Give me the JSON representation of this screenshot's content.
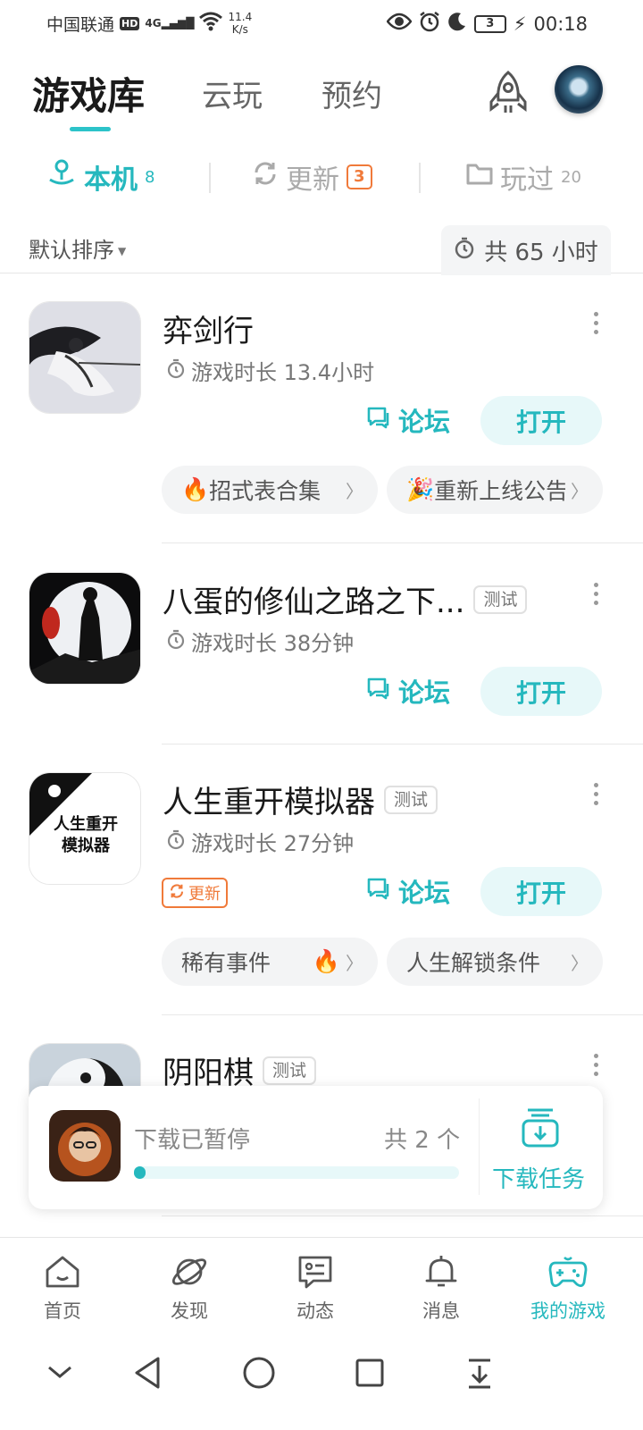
{
  "status": {
    "carrier": "中国联通",
    "hd": "HD",
    "network": "4G",
    "speed_value": "11.4",
    "speed_unit": "K/s",
    "battery": "3",
    "time": "00:18"
  },
  "tabs": [
    "游戏库",
    "云玩",
    "预约"
  ],
  "sub_tabs": {
    "local": {
      "label": "本机",
      "count": "8"
    },
    "update": {
      "label": "更新",
      "count": "3"
    },
    "played": {
      "label": "玩过",
      "count": "20"
    }
  },
  "sort": {
    "label": "默认排序",
    "total_time": "共 65 小时"
  },
  "forum_label": "论坛",
  "open_label": "打开",
  "test_tag": "测试",
  "update_tag": "更新",
  "games": [
    {
      "title": "弈剑行",
      "playtime": "游戏时长 13.4小时",
      "chips": [
        "招式表合集",
        "重新上线公告"
      ]
    },
    {
      "title": "八蛋的修仙之路之下...",
      "playtime": "游戏时长 38分钟"
    },
    {
      "title": "人生重开模拟器",
      "playtime": "游戏时长 27分钟",
      "icon_text_line1": "人生重开",
      "icon_text_line2": "模拟器",
      "chips": [
        "稀有事件",
        "人生解锁条件"
      ]
    },
    {
      "title": "阴阳棋"
    }
  ],
  "download": {
    "status": "下载已暂停",
    "count": "共 2 个",
    "task_label": "下载任务",
    "progress": 0.02
  },
  "bottom_nav": [
    "首页",
    "发现",
    "动态",
    "消息",
    "我的游戏"
  ],
  "colors": {
    "accent": "#25b8be",
    "orange": "#f07a3a"
  }
}
